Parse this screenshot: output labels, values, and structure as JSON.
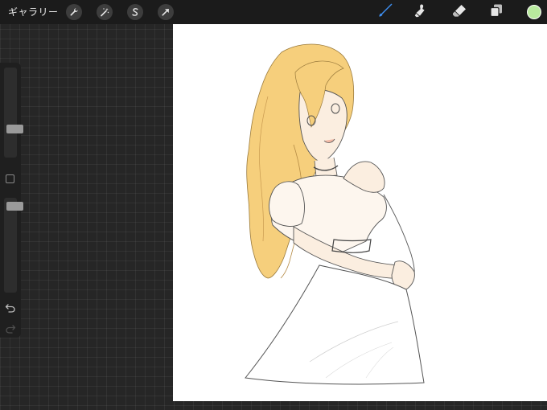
{
  "toolbar": {
    "gallery_label": "ギャラリー",
    "left_tools": [
      {
        "name": "actions",
        "icon": "wrench-icon"
      },
      {
        "name": "adjustments",
        "icon": "magic-wand-icon"
      },
      {
        "name": "selection",
        "icon": "selection-s-icon"
      },
      {
        "name": "transform",
        "icon": "transform-arrow-icon"
      }
    ],
    "right_tools": [
      {
        "name": "brush",
        "icon": "brush-icon",
        "active": true
      },
      {
        "name": "smudge",
        "icon": "smudge-icon",
        "active": false
      },
      {
        "name": "eraser",
        "icon": "eraser-icon",
        "active": false
      },
      {
        "name": "layers",
        "icon": "layers-icon",
        "active": false
      }
    ],
    "current_color": "#b9ea9e",
    "active_tool_color": "#3d8ef0"
  },
  "sidebar": {
    "size_slider_level": 0.3,
    "opacity_slider_level": 0.95
  },
  "canvas": {
    "background": "#ffffff",
    "hair_color": "#f6cf7c",
    "skin_color": "#fbeee0",
    "line_color": "#444444"
  }
}
